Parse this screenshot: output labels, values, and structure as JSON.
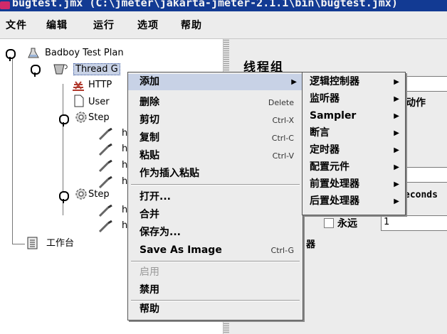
{
  "window": {
    "title": "bugtest.jmx (C:\\jmeter\\jakarta-jmeter-2.1.1\\bin\\bugtest.jmx)"
  },
  "menubar": [
    "文件",
    "编辑",
    "运行",
    "选项",
    "帮助"
  ],
  "tree": {
    "plan": "Badboy Test Plan",
    "thread_group": "Thread G",
    "http": "HTTP",
    "user": "User",
    "step1": "Step",
    "step2": "Step",
    "leaf": "h",
    "workbench": "工作台"
  },
  "right_panel": {
    "heading": "线程组",
    "frag_action": "动作",
    "frag_seconds": "econds",
    "frag_forever": "永远",
    "frag_forever_value": "1",
    "frag_scheduler": "器"
  },
  "context_menu": {
    "items": [
      {
        "label": "添加",
        "accel": "",
        "submenu": true,
        "highlighted": true
      },
      {
        "label": "删除",
        "accel": "Delete"
      },
      {
        "label": "剪切",
        "accel": "Ctrl-X"
      },
      {
        "label": "复制",
        "accel": "Ctrl-C"
      },
      {
        "label": "粘贴",
        "accel": "Ctrl-V"
      },
      {
        "label": "作为插入粘贴",
        "accel": ""
      },
      {
        "label": "打开...",
        "accel": ""
      },
      {
        "label": "合并",
        "accel": ""
      },
      {
        "label": "保存为...",
        "accel": ""
      },
      {
        "label": "Save As Image",
        "accel": "Ctrl-G"
      },
      {
        "label": "启用",
        "accel": "",
        "disabled": true
      },
      {
        "label": "禁用",
        "accel": ""
      },
      {
        "label": "帮助",
        "accel": ""
      }
    ]
  },
  "submenu": {
    "items": [
      "逻辑控制器",
      "监听器",
      "Sampler",
      "断言",
      "定时器",
      "配置元件",
      "前置处理器",
      "后置处理器"
    ]
  }
}
